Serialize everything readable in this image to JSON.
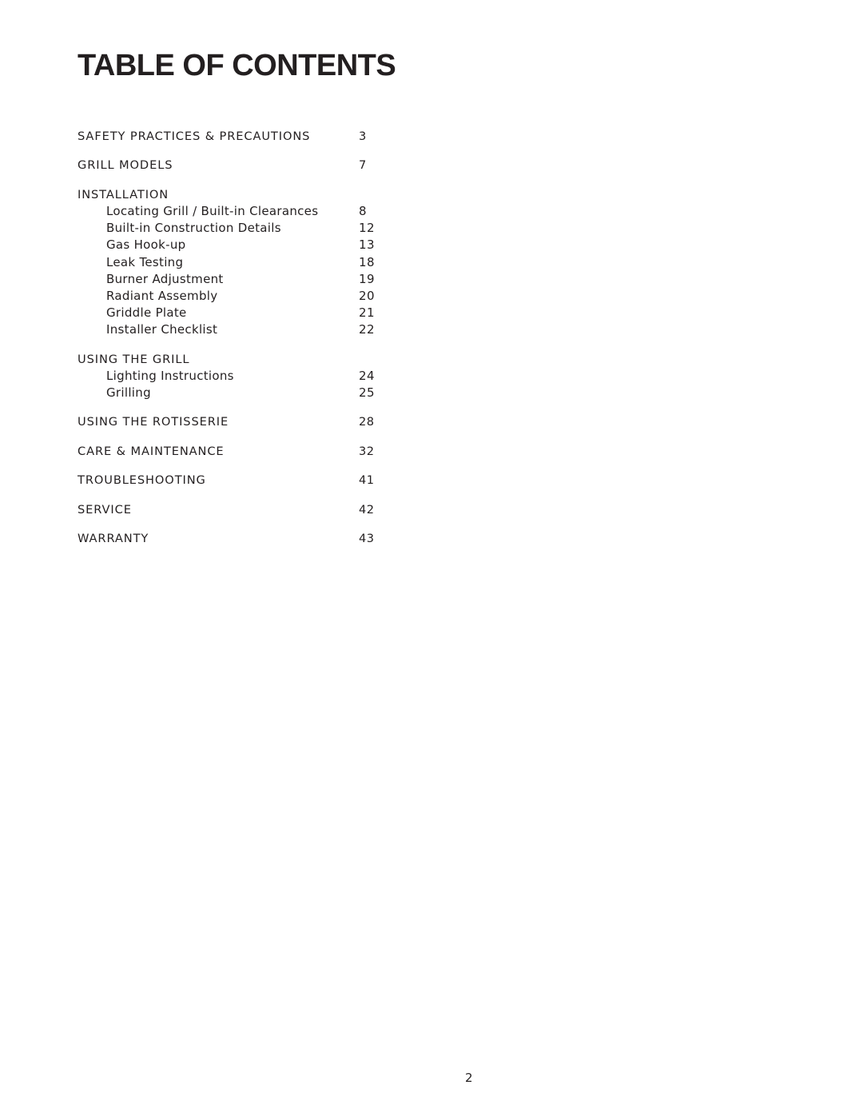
{
  "title": "TABLE OF CONTENTS",
  "entries": [
    {
      "label": "SAFETY PRACTICES & PRECAUTIONS",
      "page": "3",
      "level": "section"
    },
    {
      "label": "GRILL MODELS",
      "page": "7",
      "level": "section"
    },
    {
      "label": "INSTALLATION",
      "page": "",
      "level": "section"
    },
    {
      "label": "Locating Grill / Built-in Clearances",
      "page": "8",
      "level": "sub"
    },
    {
      "label": "Built-in Construction Details",
      "page": "12",
      "level": "sub"
    },
    {
      "label": "Gas Hook-up",
      "page": "13",
      "level": "sub"
    },
    {
      "label": "Leak Testing",
      "page": "18",
      "level": "sub"
    },
    {
      "label": "Burner Adjustment",
      "page": "19",
      "level": "sub"
    },
    {
      "label": "Radiant Assembly",
      "page": "20",
      "level": "sub"
    },
    {
      "label": "Griddle Plate",
      "page": "21",
      "level": "sub"
    },
    {
      "label": "Installer Checklist",
      "page": "22",
      "level": "sub"
    },
    {
      "label": "USING THE GRILL",
      "page": "",
      "level": "section"
    },
    {
      "label": "Lighting Instructions",
      "page": "24",
      "level": "sub"
    },
    {
      "label": "Grilling",
      "page": "25",
      "level": "sub"
    },
    {
      "label": "USING THE ROTISSERIE",
      "page": "28",
      "level": "section"
    },
    {
      "label": "CARE & MAINTENANCE",
      "page": "32",
      "level": "section"
    },
    {
      "label": "TROUBLESHOOTING",
      "page": "41",
      "level": "section"
    },
    {
      "label": "SERVICE",
      "page": "42",
      "level": "section"
    },
    {
      "label": "WARRANTY",
      "page": "43",
      "level": "section"
    }
  ],
  "page_number": "2"
}
